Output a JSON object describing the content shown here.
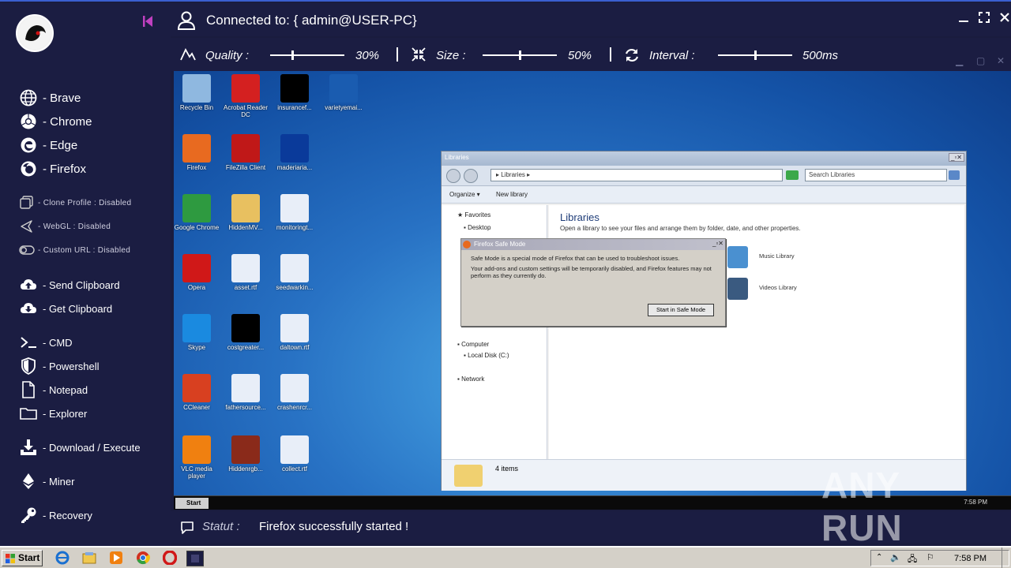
{
  "header": {
    "title": "Connected to: { admin@USER-PC}"
  },
  "controls": {
    "quality_label": "Quality :",
    "quality_value": "30%",
    "quality_level": 0.3,
    "size_label": "Size :",
    "size_value": "50%",
    "size_level": 0.5,
    "interval_label": "Interval :",
    "interval_value": "500ms",
    "interval_level": 0.5
  },
  "sidebar": {
    "browsers": [
      {
        "label": "- Brave",
        "icon": "globe-icon"
      },
      {
        "label": "- Chrome",
        "icon": "chrome-icon"
      },
      {
        "label": "- Edge",
        "icon": "edge-icon"
      },
      {
        "label": "- Firefox",
        "icon": "firefox-icon"
      }
    ],
    "options": [
      {
        "label": "- Clone Profile : Disabled",
        "icon": "clone-icon"
      },
      {
        "label": "- WebGL : Disabled",
        "icon": "webgl-icon"
      },
      {
        "label": "- Custom URL : Disabled",
        "icon": "toggle-icon"
      }
    ],
    "clipboard": [
      {
        "label": "- Send Clipboard",
        "icon": "cloud-upload-icon"
      },
      {
        "label": "- Get Clipboard",
        "icon": "cloud-download-icon"
      }
    ],
    "tools": [
      {
        "label": "- CMD",
        "icon": "terminal-icon"
      },
      {
        "label": "- Powershell",
        "icon": "shield-icon"
      },
      {
        "label": "- Notepad",
        "icon": "file-icon"
      },
      {
        "label": "- Explorer",
        "icon": "folder-icon"
      }
    ],
    "extras": [
      {
        "label": "- Download / Execute",
        "icon": "download-icon"
      },
      {
        "label": "- Miner",
        "icon": "ethereum-icon"
      },
      {
        "label": "- Recovery",
        "icon": "key-icon"
      }
    ]
  },
  "remote_desktop": {
    "icons": [
      {
        "caption": "Recycle Bin",
        "color": "#8fb8e0"
      },
      {
        "caption": "Acrobat Reader DC",
        "color": "#d42020"
      },
      {
        "caption": "insurancef...",
        "color": "#000000"
      },
      {
        "caption": "varietyemai...",
        "color": "#1a5cb0"
      },
      {
        "caption": "Firefox",
        "color": "#e86a20"
      },
      {
        "caption": "FileZilla Client",
        "color": "#c01818"
      },
      {
        "caption": "maderiaria...",
        "color": "#0a3a9a"
      },
      {
        "caption": "Google Chrome",
        "color": "#2e9a40"
      },
      {
        "caption": "HiddenMV...",
        "color": "#e8c060"
      },
      {
        "caption": "monitoringt...",
        "color": "#e8eef8"
      },
      {
        "caption": "Opera",
        "color": "#d01818"
      },
      {
        "caption": "asset.rtf",
        "color": "#e8eef8"
      },
      {
        "caption": "seedwarkin...",
        "color": "#e8eef8"
      },
      {
        "caption": "Skype",
        "color": "#1a8ae0"
      },
      {
        "caption": "costgreater...",
        "color": "#000000"
      },
      {
        "caption": "daltown.rtf",
        "color": "#e8eef8"
      },
      {
        "caption": "CCleaner",
        "color": "#d84020"
      },
      {
        "caption": "fathersource...",
        "color": "#e8eef8"
      },
      {
        "caption": "crashenrcr...",
        "color": "#e8eef8"
      },
      {
        "caption": "VLC media player",
        "color": "#f08010"
      },
      {
        "caption": "Hiddenrgb...",
        "color": "#8a2a1a"
      },
      {
        "caption": "collect.rtf",
        "color": "#e8eef8"
      }
    ],
    "explorer": {
      "title": "Libraries",
      "address": "▸ Libraries ▸",
      "search_placeholder": "Search Libraries",
      "organize": "Organize ▾",
      "new_library": "New library",
      "nav": [
        "Favorites",
        "Desktop",
        "Computer",
        "Local Disk (C:)",
        "Network"
      ],
      "heading": "Libraries",
      "subheading": "Open a library to see your files and arrange them by folder, date, and other properties.",
      "libraries": [
        "Music Library",
        "Videos Library"
      ],
      "status": "4 items"
    },
    "dialog": {
      "title": "Firefox Safe Mode",
      "line1": "Safe Mode is a special mode of Firefox that can be used to troubleshoot issues.",
      "line2": "Your add-ons and custom settings will be temporarily disabled, and Firefox features may not perform as they currently do.",
      "button": "Start in Safe Mode"
    },
    "taskbar": {
      "start": "Start",
      "clock": "7:58 PM"
    }
  },
  "status": {
    "label": "Statut :",
    "message": "Firefox successfully started !"
  },
  "watermark": "ANY RUN",
  "host_taskbar": {
    "start": "Start",
    "clock": "7:58 PM"
  }
}
